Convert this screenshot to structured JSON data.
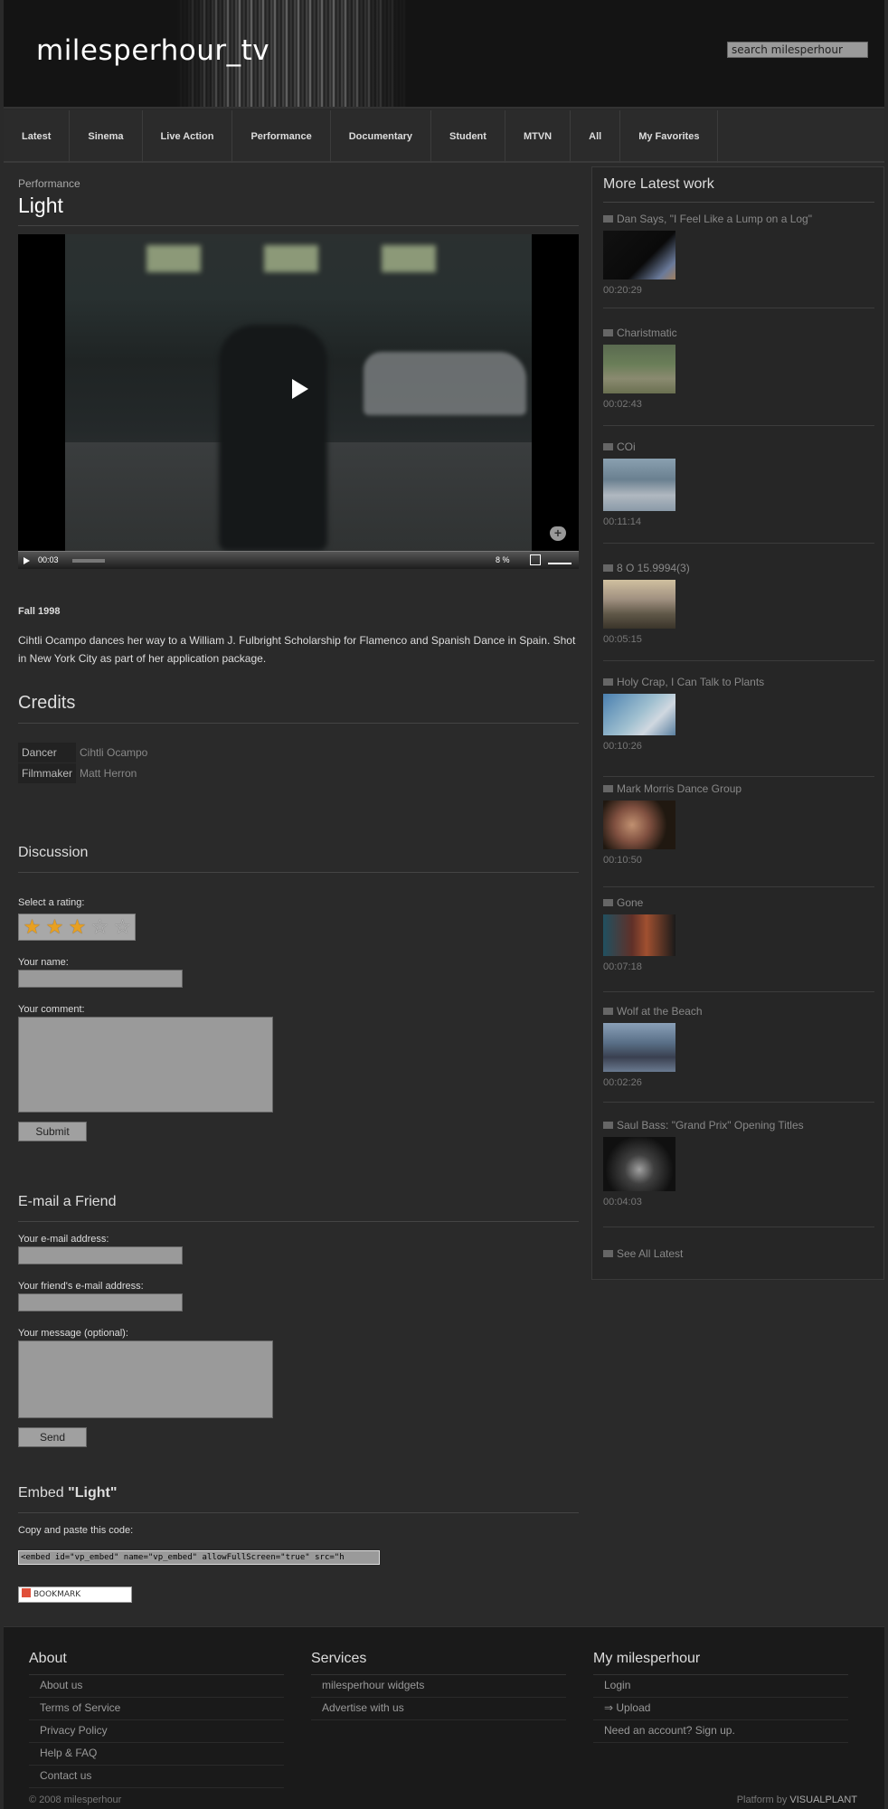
{
  "site": {
    "logo": "milesperhour_tv",
    "search_placeholder": "search milesperhour"
  },
  "nav": [
    {
      "label": "Latest"
    },
    {
      "label": "Sinema"
    },
    {
      "label": "Live Action"
    },
    {
      "label": "Performance"
    },
    {
      "label": "Documentary"
    },
    {
      "label": "Student"
    },
    {
      "label": "MTVN"
    },
    {
      "label": "All"
    },
    {
      "label": "My Favorites"
    }
  ],
  "video": {
    "category": "Performance",
    "title": "Light",
    "time": "00:03",
    "buffer": "8 %",
    "date": "Fall 1998",
    "description": "Cihtli Ocampo dances her way to a William J. Fulbright Scholarship for Flamenco and Spanish Dance in Spain. Shot in New York City as part of her application package."
  },
  "credits": {
    "heading": "Credits",
    "rows": [
      {
        "role": "Dancer",
        "name": "Cihtli Ocampo"
      },
      {
        "role": "Filmmaker",
        "name": "Matt Herron"
      }
    ]
  },
  "discussion": {
    "heading": "Discussion",
    "rating_label": "Select a rating:",
    "rating": 3,
    "rating_max": 5,
    "name_label": "Your name:",
    "comment_label": "Your comment:",
    "submit": "Submit"
  },
  "email_friend": {
    "heading": "E-mail a Friend",
    "your_email": "Your e-mail address:",
    "friend_email": "Your friend's e-mail address:",
    "message": "Your message (optional):",
    "send": "Send"
  },
  "embed": {
    "heading_prefix": "Embed ",
    "heading_title": "\"Light\"",
    "copy_label": "Copy and paste this code:",
    "code": "<embed id=\"vp_embed\" name=\"vp_embed\" allowFullScreen=\"true\" src=\"h",
    "bookmark": "BOOKMARK"
  },
  "sidebar": {
    "title": "More Latest work",
    "items": [
      {
        "name": "Dan Says, \"I Feel Like a Lump on a Log\"",
        "duration": "00:20:29"
      },
      {
        "name": "Charistmatic",
        "duration": "00:02:43"
      },
      {
        "name": "COi",
        "duration": "00:11:14"
      },
      {
        "name": "8 O 15.9994(3)",
        "duration": "00:05:15"
      },
      {
        "name": "Holy Crap, I Can Talk to Plants",
        "duration": "00:10:26"
      },
      {
        "name": "Mark Morris Dance Group",
        "duration": "00:10:50"
      },
      {
        "name": "Gone",
        "duration": "00:07:18"
      },
      {
        "name": "Wolf at the Beach",
        "duration": "00:02:26"
      },
      {
        "name": "Saul Bass: \"Grand Prix\" Opening Titles",
        "duration": "00:04:03"
      }
    ],
    "see_all": "See All Latest"
  },
  "footer": {
    "about": {
      "heading": "About",
      "links": [
        "About us",
        "Terms of Service",
        "Privacy Policy",
        "Help & FAQ",
        "Contact us"
      ]
    },
    "services": {
      "heading": "Services",
      "links": [
        "milesperhour widgets",
        "Advertise with us"
      ]
    },
    "my": {
      "heading": "My milesperhour",
      "links": [
        "Login",
        "⇒ Upload",
        "Need an account? Sign up."
      ]
    },
    "copyright": "© 2008 milesperhour",
    "platform_prefix": "Platform by ",
    "platform_name": "VISUALPLANT"
  }
}
